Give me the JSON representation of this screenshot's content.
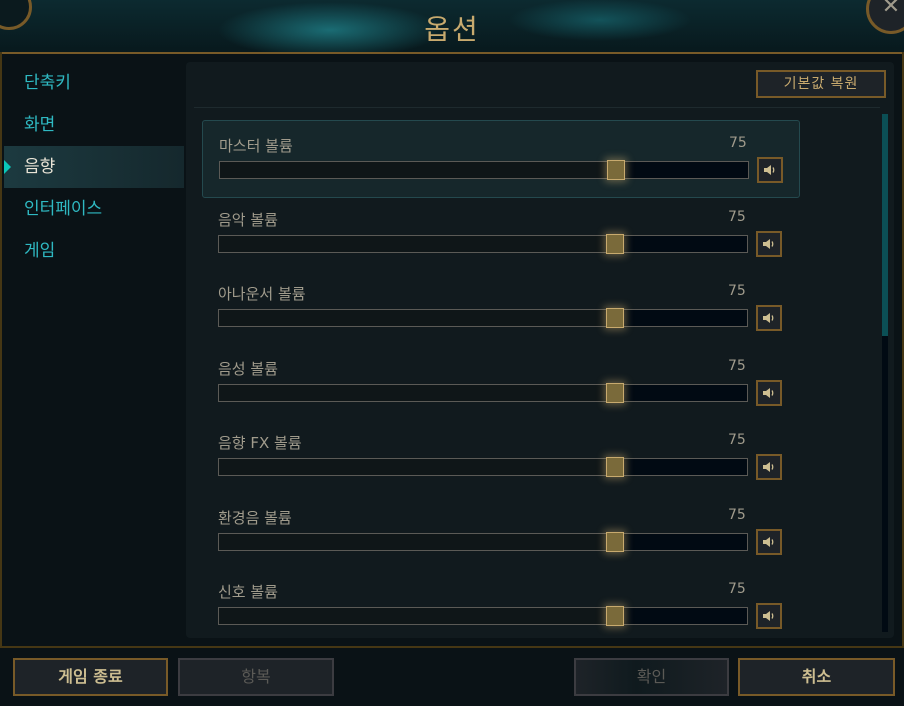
{
  "window": {
    "title": "옵션"
  },
  "sidebar": {
    "items": [
      {
        "label": "단축키",
        "active": false
      },
      {
        "label": "화면",
        "active": false
      },
      {
        "label": "음향",
        "active": true
      },
      {
        "label": "인터페이스",
        "active": false
      },
      {
        "label": "게임",
        "active": false
      }
    ]
  },
  "panel": {
    "restore_label": "기본값 복원"
  },
  "volumes": [
    {
      "label": "마스터 볼륨",
      "value": "75",
      "highlighted": true
    },
    {
      "label": "음악 볼륨",
      "value": "75"
    },
    {
      "label": "아나운서 볼륨",
      "value": "75"
    },
    {
      "label": "음성 볼륨",
      "value": "75"
    },
    {
      "label": "음향 FX 볼륨",
      "value": "75"
    },
    {
      "label": "환경음 볼륨",
      "value": "75"
    },
    {
      "label": "신호 볼륨",
      "value": "75"
    }
  ],
  "footer": {
    "quit_label": "게임 종료",
    "surrender_label": "항복",
    "confirm_label": "확인",
    "cancel_label": "취소"
  },
  "colors": {
    "gold": "#c8aa6e",
    "gold_border": "#785a28",
    "teal_accent": "#0ac8b9",
    "sidebar_text": "#2fb9c2",
    "background": "#0a1216"
  },
  "icons": {
    "close": "close-icon",
    "mute": "speaker-icon",
    "active_marker": "caret-right-icon"
  }
}
